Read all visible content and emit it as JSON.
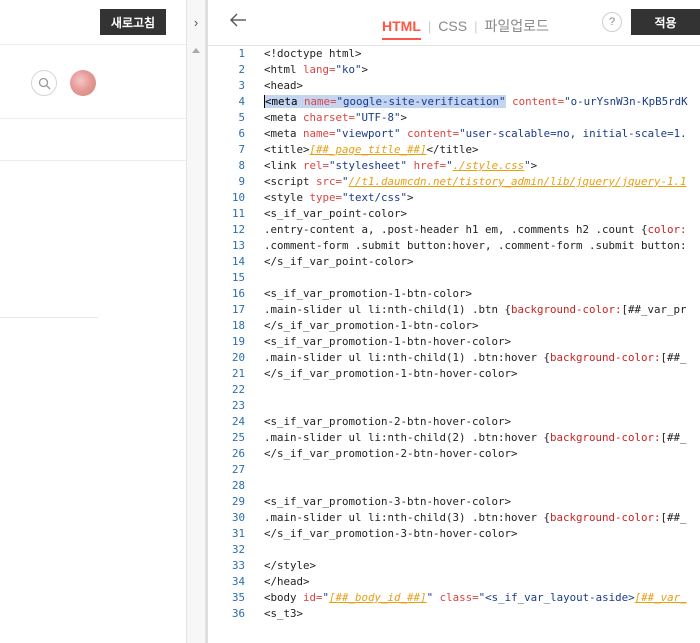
{
  "left_panel": {
    "refresh_label": "새로고침",
    "collapse_icon": "chevron-right-icon"
  },
  "editor_header": {
    "tabs": [
      "HTML",
      "CSS",
      "파일업로드"
    ],
    "active_tab": "HTML",
    "help_label": "?",
    "apply_label": "적용"
  },
  "code_lines": [
    {
      "n": "1",
      "parts": [
        [
          "ct",
          "<!doctype html>"
        ]
      ]
    },
    {
      "n": "2",
      "parts": [
        [
          "ct",
          "<html "
        ],
        [
          "attr",
          "lang="
        ],
        [
          "str",
          "\"ko\""
        ],
        [
          "ct",
          ">"
        ]
      ]
    },
    {
      "n": "3",
      "parts": [
        [
          "ct",
          "<head>"
        ]
      ]
    },
    {
      "n": "4",
      "parts": [
        [
          "sel",
          "<meta "
        ],
        [
          "sel attr",
          "name="
        ],
        [
          "sel str",
          "\"google-site-verification\""
        ],
        [
          "ct",
          " "
        ],
        [
          "attr",
          "content="
        ],
        [
          "str",
          "\"o-urYsnW3n-KpB5rdK"
        ]
      ]
    },
    {
      "n": "5",
      "parts": [
        [
          "ct",
          "<meta "
        ],
        [
          "attr",
          "charset="
        ],
        [
          "str",
          "\"UTF-8\""
        ],
        [
          "ct",
          ">"
        ]
      ]
    },
    {
      "n": "6",
      "parts": [
        [
          "ct",
          "<meta "
        ],
        [
          "attr",
          "name="
        ],
        [
          "str",
          "\"viewport\""
        ],
        [
          "ct",
          " "
        ],
        [
          "attr",
          "content="
        ],
        [
          "str",
          "\"user-scalable=no, initial-scale=1."
        ]
      ]
    },
    {
      "n": "7",
      "parts": [
        [
          "ct",
          "<title>"
        ],
        [
          "tpl",
          "[##_page_title_##]"
        ],
        [
          "ct",
          "</title>"
        ]
      ]
    },
    {
      "n": "8",
      "parts": [
        [
          "ct",
          "<link "
        ],
        [
          "attr",
          "rel="
        ],
        [
          "str",
          "\"stylesheet\""
        ],
        [
          "ct",
          " "
        ],
        [
          "attr",
          "href="
        ],
        [
          "str",
          "\""
        ],
        [
          "tpl",
          "./style.css"
        ],
        [
          "str",
          "\""
        ],
        [
          "ct",
          ">"
        ]
      ]
    },
    {
      "n": "9",
      "parts": [
        [
          "ct",
          "<script "
        ],
        [
          "attr",
          "src="
        ],
        [
          "str",
          "\""
        ],
        [
          "tpl",
          "//t1.daumcdn.net/tistory_admin/lib/jquery/jquery-1.1"
        ]
      ]
    },
    {
      "n": "10",
      "parts": [
        [
          "ct",
          "<style "
        ],
        [
          "attr",
          "type="
        ],
        [
          "str",
          "\"text/css\""
        ],
        [
          "ct",
          ">"
        ]
      ]
    },
    {
      "n": "11",
      "parts": [
        [
          "ct",
          "<s_if_var_point-color>"
        ]
      ]
    },
    {
      "n": "12",
      "parts": [
        [
          "ct",
          ".entry-content a, .post-header h1 em, .comments h2 .count {"
        ],
        [
          "sty",
          "color:"
        ]
      ]
    },
    {
      "n": "13",
      "parts": [
        [
          "ct",
          ".comment-form .submit button:hover, .comment-form .submit button:"
        ]
      ]
    },
    {
      "n": "14",
      "parts": [
        [
          "ct",
          "</s_if_var_point-color>"
        ]
      ]
    },
    {
      "n": "15",
      "parts": []
    },
    {
      "n": "16",
      "parts": [
        [
          "ct",
          "<s_if_var_promotion-1-btn-color>"
        ]
      ]
    },
    {
      "n": "17",
      "parts": [
        [
          "ct",
          ".main-slider ul li:nth-child(1) .btn {"
        ],
        [
          "sty",
          "background-color:"
        ],
        [
          "ct",
          "[##_var_pr"
        ]
      ]
    },
    {
      "n": "18",
      "parts": [
        [
          "ct",
          "</s_if_var_promotion-1-btn-color>"
        ]
      ]
    },
    {
      "n": "19",
      "parts": [
        [
          "ct",
          "<s_if_var_promotion-1-btn-hover-color>"
        ]
      ]
    },
    {
      "n": "20",
      "parts": [
        [
          "ct",
          ".main-slider ul li:nth-child(1) .btn:hover {"
        ],
        [
          "sty",
          "background-color:"
        ],
        [
          "ct",
          "[##_"
        ]
      ]
    },
    {
      "n": "21",
      "parts": [
        [
          "ct",
          "</s_if_var_promotion-1-btn-hover-color>"
        ]
      ]
    },
    {
      "n": "22",
      "parts": []
    },
    {
      "n": "23",
      "parts": []
    },
    {
      "n": "24",
      "parts": [
        [
          "ct",
          "<s_if_var_promotion-2-btn-hover-color>"
        ]
      ]
    },
    {
      "n": "25",
      "parts": [
        [
          "ct",
          ".main-slider ul li:nth-child(2) .btn:hover {"
        ],
        [
          "sty",
          "background-color:"
        ],
        [
          "ct",
          "[##_"
        ]
      ]
    },
    {
      "n": "26",
      "parts": [
        [
          "ct",
          "</s_if_var_promotion-2-btn-hover-color>"
        ]
      ]
    },
    {
      "n": "27",
      "parts": []
    },
    {
      "n": "28",
      "parts": []
    },
    {
      "n": "29",
      "parts": [
        [
          "ct",
          "<s_if_var_promotion-3-btn-hover-color>"
        ]
      ]
    },
    {
      "n": "30",
      "parts": [
        [
          "ct",
          ".main-slider ul li:nth-child(3) .btn:hover {"
        ],
        [
          "sty",
          "background-color:"
        ],
        [
          "ct",
          "[##_"
        ]
      ]
    },
    {
      "n": "31",
      "parts": [
        [
          "ct",
          "</s_if_var_promotion-3-btn-hover-color>"
        ]
      ]
    },
    {
      "n": "32",
      "parts": []
    },
    {
      "n": "33",
      "parts": [
        [
          "ct",
          "</style>"
        ]
      ]
    },
    {
      "n": "34",
      "parts": [
        [
          "ct",
          "</head>"
        ]
      ]
    },
    {
      "n": "35",
      "parts": [
        [
          "ct",
          "<body "
        ],
        [
          "attr",
          "id="
        ],
        [
          "str",
          "\""
        ],
        [
          "tpl",
          "[##_body_id_##]"
        ],
        [
          "str",
          "\""
        ],
        [
          "ct",
          " "
        ],
        [
          "attr",
          "class="
        ],
        [
          "str",
          "\"<s_if_var_layout-aside>"
        ],
        [
          "tpl",
          "[##_var_"
        ]
      ]
    },
    {
      "n": "36",
      "parts": [
        [
          "ct",
          "<s_t3>"
        ]
      ]
    }
  ]
}
